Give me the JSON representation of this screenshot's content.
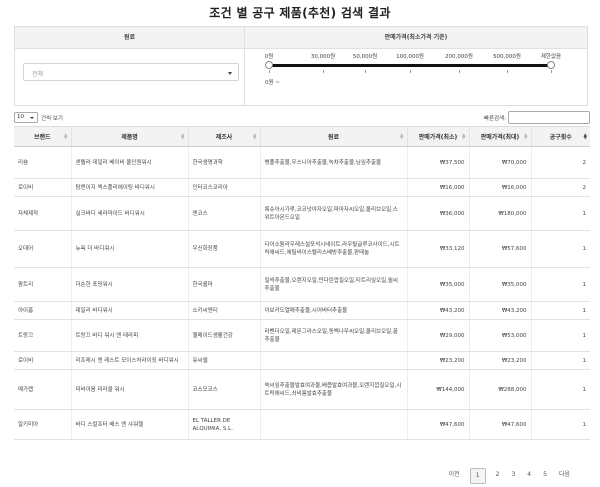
{
  "title": "조건 별 공구 제품(추천) 검색 결과",
  "filter": {
    "ingredient_header": "원료",
    "price_header": "판매가격(최소가격 기준)",
    "ingredient_placeholder": "전체",
    "price_ticks": [
      "0원",
      "30,000원",
      "50,000원",
      "100,000원",
      "200,000원",
      "500,000원",
      "제한없음"
    ],
    "price_range": "0원 ~"
  },
  "controls": {
    "page_length": "10",
    "page_length_label": "건씩 보기",
    "search_label": "빠른검색:",
    "search_value": ""
  },
  "table": {
    "columns": [
      "브랜드",
      "제품명",
      "제조사",
      "원료",
      "판매가격(최소)",
      "판매가격(최대)",
      "공구횟수"
    ],
    "rows": [
      [
        "리슘",
        "센텔라 데일리 베이비 올인원워시",
        "한국생명과학",
        "병풀추출물,우스니아추출물,녹차추출물,님잎추출물",
        "₩37,500",
        "₩70,000",
        "2"
      ],
      [
        "로이비",
        "탐앤이지 엑스플리에이팅 바디워시",
        "인터코스코리아",
        "",
        "₩16,000",
        "₩16,000",
        "2"
      ],
      [
        "자체제작",
        "실크바디 세라마이드 바디워시",
        "엔코스",
        "록슈아시가루,코코넛야자오일,파마자씨오일,올리브오일,스위트아몬드오일",
        "₩36,000",
        "₩180,000",
        "1"
      ],
      [
        "오데어",
        "뉴욕 더 바디워시",
        "우신화장품",
        "다이소듐라우레스설포석시네이트,라우릴글루코사이드,시트릭애씨드,에틸바이스렐리스베방추출물,판테놀",
        "₩33,120",
        "₩57,600",
        "1"
      ],
      [
        "팜트리",
        "더순한 포밍워시",
        "한국콜마",
        "밀싹추출물,오렌지오일,만다린껍질오일,티트리잎오일,월씨추출물",
        "₩35,000",
        "₩35,000",
        "1"
      ],
      [
        "아이홉",
        "데일리 바디워시",
        "소키씨엔티",
        "아보카도열매추출물,시어버터추출물",
        "₩43,200",
        "₩43,200",
        "1"
      ],
      [
        "트랑끄",
        "트랑끄 바디 워시 앤 테라피",
        "헬메이드생활건강",
        "라벤더오일,레몬그라스오일,동백나무씨오일,올리브오일,꿀추출물",
        "₩29,000",
        "₩53,000",
        "1"
      ],
      [
        "로이비",
        "리프레시 앤 레스트 모이스처라이징 바디워시",
        "유씨엘",
        "",
        "₩23,200",
        "₩23,200",
        "1"
      ],
      [
        "메가랩",
        "미바이옴 미라클 워시",
        "코스모코스",
        "쑥씨잎추출물발효여과물,배즙발효여과물,오렌지껍질오일,시트릭애씨드,쇠비름발효추출물",
        "₩144,000",
        "₩288,000",
        "1"
      ],
      [
        "알키미아",
        "바디 스컬프터 배스 앤 샤워젤",
        "EL TALLER DE ALQUIMIA, S.L.",
        "",
        "₩47,600",
        "₩47,600",
        "1"
      ]
    ]
  },
  "pager": {
    "prev": "이전",
    "pages": [
      "1",
      "2",
      "3",
      "4",
      "5"
    ],
    "current": "1",
    "next": "다음"
  }
}
